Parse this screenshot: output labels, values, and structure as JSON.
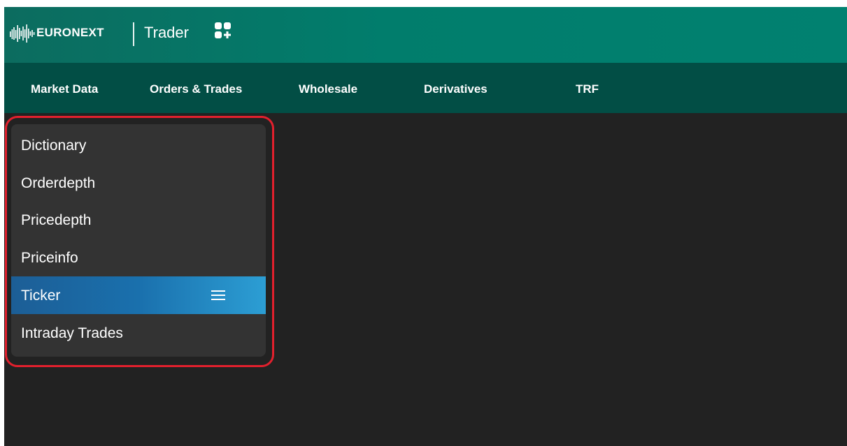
{
  "header": {
    "brand": "EURONEXT",
    "product": "Trader",
    "logo_icon": "euronext-logo-icon",
    "apps_icon": "apps-grid-plus-icon"
  },
  "nav": {
    "items": [
      {
        "label": "Market Data"
      },
      {
        "label": "Orders & Trades"
      },
      {
        "label": "Wholesale"
      },
      {
        "label": "Derivatives"
      },
      {
        "label": "TRF"
      }
    ]
  },
  "dropdown": {
    "items": [
      {
        "label": "Dictionary",
        "active": false
      },
      {
        "label": "Orderdepth",
        "active": false
      },
      {
        "label": "Pricedepth",
        "active": false
      },
      {
        "label": "Priceinfo",
        "active": false
      },
      {
        "label": "Ticker",
        "active": true
      },
      {
        "label": "Intraday Trades",
        "active": false
      }
    ],
    "active_icon": "menu-lines-icon"
  },
  "colors": {
    "header_green": "#017d6c",
    "nav_green": "#024e45",
    "background": "#222222",
    "menu_bg": "#333333",
    "active_blue": "#1a70ad",
    "highlight_red": "#e2202d"
  }
}
